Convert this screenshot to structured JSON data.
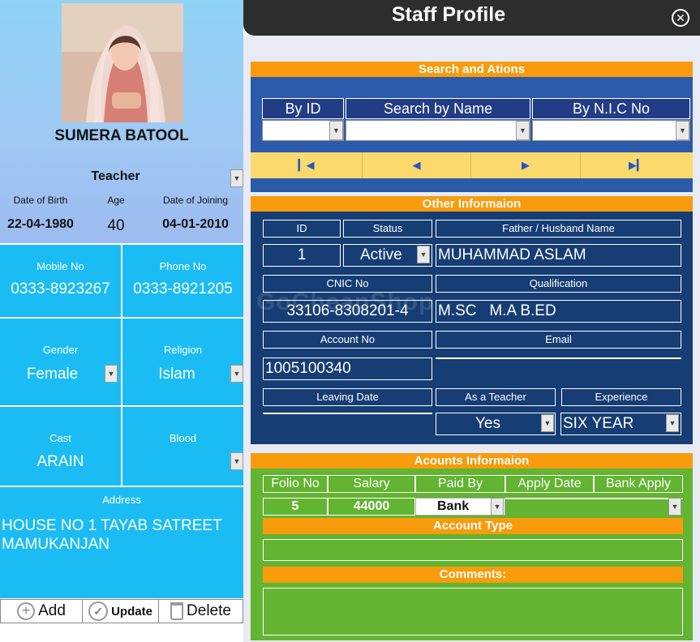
{
  "profile": {
    "name": "SUMERA BATOOL",
    "designation": "Teacher",
    "dob_label": "Date of Birth",
    "dob": "22-04-1980",
    "age_label": "Age",
    "age": "40",
    "doj_label": "Date of Joining",
    "doj": "04-01-2010"
  },
  "contact": {
    "mobile_label": "Mobile No",
    "mobile": "0333-8923267",
    "phone_label": "Phone No",
    "phone": "0333-8921205",
    "gender_label": "Gender",
    "gender": "Female",
    "religion_label": "Religion",
    "religion": "Islam",
    "cast_label": "Cast",
    "cast": "ARAIN",
    "blood_label": "Blood",
    "blood": "",
    "address_label": "Address",
    "address": "HOUSE NO 1 TAYAB SATREET MAMUKANJAN"
  },
  "actions": {
    "add": "Add",
    "update": "Update",
    "delete": "Delete"
  },
  "window": {
    "title": "Staff Profile",
    "close_icon": "close-icon"
  },
  "search": {
    "section_title": "Search and Ations",
    "by_id": "By ID",
    "by_name": "Search by Name",
    "by_nic": "By N.I.C No"
  },
  "other": {
    "section_title": "Other Informaion",
    "id_label": "ID",
    "id": "1",
    "status_label": "Status",
    "status": "Active",
    "father_label": "Father / Husband Name",
    "father": "MUHAMMAD ASLAM",
    "cnic_label": "CNIC No",
    "cnic": "33106-8308201-4",
    "qual_label": "Qualification",
    "qual": "M.SC   M.A B.ED",
    "account_label": "Account No",
    "account": "1005100340",
    "email_label": "Email",
    "email": "",
    "leaving_label": "Leaving Date",
    "leaving": "",
    "teacher_label": "As a Teacher",
    "teacher": "Yes",
    "exp_label": "Experience",
    "exp": "SIX YEAR"
  },
  "accounts": {
    "section_title": "Acounts Informaion",
    "folio_label": "Folio No",
    "folio": "5",
    "salary_label": "Salary",
    "salary": "44000",
    "paid_label": "Paid By",
    "paid": "Bank",
    "apply_date_label": "Apply Date",
    "apply_date": "",
    "bank_apply_label": "Bank Apply",
    "bank_apply": "",
    "account_type_label": "Account Type",
    "comments_label": "Comments:"
  },
  "watermark": "GoCheapShop",
  "colors": {
    "title_bar": "#2d2d2d",
    "section_header": "#f89b0c",
    "search_blue": "#2c5aaa",
    "other_navy": "#163d74",
    "accounts_green": "#62b431",
    "left_cyan": "#1bbcf3"
  }
}
